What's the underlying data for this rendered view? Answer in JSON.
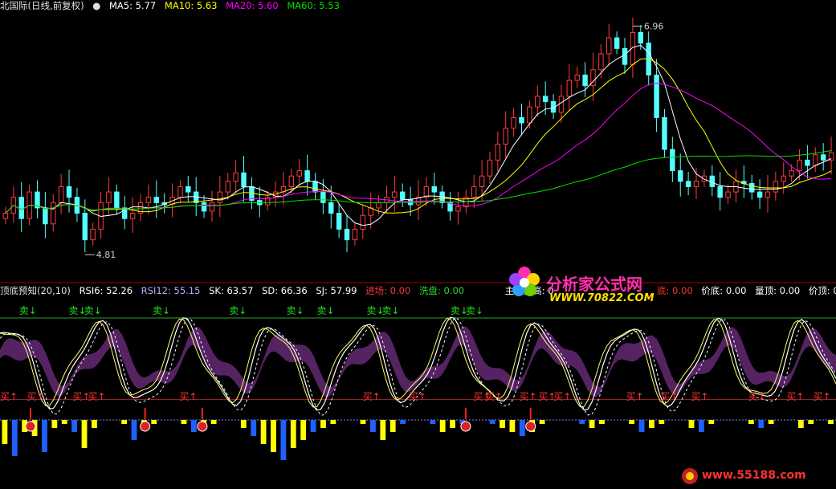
{
  "top_header": {
    "title": "北国际(日线,前复权)",
    "ma5": "MA5: 5.77",
    "ma10": "MA10: 5.63",
    "ma20": "MA20: 5.60",
    "ma60": "MA60: 5.53"
  },
  "bottom_header": {
    "title": "顶底预知(20,10)",
    "rsi6": "RSI6: 52.26",
    "rsi12": "RSI12: 55.15",
    "sk": "SK: 63.57",
    "sd": "SD: 66.36",
    "sj": "SJ: 57.99",
    "entry": "进场: 0.00",
    "wash": "洗盘: 0.00",
    "main_raise": "主力拉高: 0",
    "bottom": "底: 0.00",
    "price_bottom": "价底: 0.00",
    "vol_top": "量顶: 0.00",
    "price_top": "价顶: 0.00"
  },
  "watermarks": {
    "site_name": "分析家公式网",
    "site_url": "WWW.70822.COM",
    "corner_url": "www.55188.com"
  },
  "colors": {
    "background": "#000000",
    "candle_up": "#ff3c3c",
    "candle_down": "#54ffff",
    "ma5": "#ffffff",
    "ma10": "#ffff00",
    "ma20": "#ff00ff",
    "ma60": "#00e000",
    "buy_label": "#ff3333",
    "sell_label": "#22dd22",
    "hist_yellow": "#ffff00",
    "hist_blue": "#2060ff"
  },
  "chart_data": [
    {
      "type": "candlestick",
      "title": "北国际(日线,前复权)",
      "ylim": [
        4.6,
        7.1
      ],
      "annotations": [
        {
          "label": "6.96",
          "value": 6.96,
          "kind": "high"
        },
        {
          "label": "4.81",
          "value": 4.81,
          "kind": "low"
        }
      ],
      "closes": [
        5.2,
        5.35,
        5.15,
        5.4,
        5.25,
        5.1,
        5.3,
        5.45,
        5.35,
        5.2,
        4.95,
        5.05,
        5.3,
        5.4,
        5.25,
        5.15,
        5.2,
        5.3,
        5.35,
        5.3,
        5.28,
        5.35,
        5.45,
        5.4,
        5.3,
        5.22,
        5.3,
        5.4,
        5.5,
        5.58,
        5.45,
        5.32,
        5.28,
        5.35,
        5.4,
        5.45,
        5.55,
        5.6,
        5.5,
        5.4,
        5.3,
        5.2,
        5.05,
        4.95,
        5.05,
        5.18,
        5.25,
        5.3,
        5.35,
        5.4,
        5.33,
        5.28,
        5.35,
        5.45,
        5.4,
        5.3,
        5.22,
        5.26,
        5.35,
        5.45,
        5.55,
        5.7,
        5.85,
        6.0,
        6.1,
        6.05,
        6.2,
        6.3,
        6.25,
        6.15,
        6.3,
        6.45,
        6.5,
        6.4,
        6.55,
        6.7,
        6.85,
        6.75,
        6.6,
        6.9,
        6.8,
        6.5,
        6.1,
        5.8,
        5.6,
        5.5,
        5.45,
        5.5,
        5.55,
        5.45,
        5.35,
        5.4,
        5.5,
        5.48,
        5.4,
        5.35,
        5.4,
        5.5,
        5.55,
        5.6,
        5.7,
        5.65,
        5.75,
        5.7,
        5.77
      ],
      "series": [
        {
          "name": "MA5",
          "value": 5.77
        },
        {
          "name": "MA10",
          "value": 5.63
        },
        {
          "name": "MA20",
          "value": 5.6
        },
        {
          "name": "MA60",
          "value": 5.53
        }
      ]
    },
    {
      "type": "line",
      "title": "顶底预知(20,10)",
      "ylim": [
        0,
        100
      ],
      "reference_lines": [
        100,
        20,
        0
      ],
      "series": [
        {
          "name": "RSI6",
          "value": 52.26
        },
        {
          "name": "RSI12",
          "value": 55.15
        },
        {
          "name": "SK",
          "value": 63.57
        },
        {
          "name": "SD",
          "value": 66.36
        },
        {
          "name": "SJ",
          "value": 57.99
        }
      ],
      "sell_label": "卖↓",
      "buy_label": "买↑",
      "sell_markers_at": [
        5,
        18,
        22,
        40,
        60,
        75,
        83,
        96,
        100,
        118,
        122
      ],
      "buy_markers_at": [
        0,
        7,
        19,
        23,
        47,
        95,
        107,
        124,
        127,
        136,
        141,
        145,
        164,
        173,
        181,
        196,
        206,
        213
      ],
      "bottom_markers_at": [
        8,
        38,
        53,
        122,
        139
      ],
      "histogram": [
        0.6,
        0.9,
        0.3,
        0.4,
        0.8,
        0.2,
        0.1,
        0.3,
        0.7,
        0.2,
        0,
        0,
        0.1,
        0.5,
        0.2,
        0.1,
        0,
        0,
        0.1,
        0.3,
        0.2,
        0.1,
        0,
        0,
        0.2,
        0.4,
        0.6,
        0.8,
        1.0,
        0.7,
        0.5,
        0.3,
        0.2,
        0.1,
        0,
        0,
        0.1,
        0.3,
        0.5,
        0.3,
        0.1,
        0,
        0,
        0.1,
        0.3,
        0.2,
        0.1,
        0,
        0,
        0.1,
        0.2,
        0.3,
        0.4,
        0.3,
        0.1,
        0,
        0,
        0,
        0.1,
        0.2,
        0.1,
        0,
        0,
        0.1,
        0.3,
        0.2,
        0.1,
        0,
        0,
        0.2,
        0.3,
        0.1,
        0,
        0,
        0,
        0.1,
        0.2,
        0.1,
        0,
        0,
        0.2,
        0.1,
        0,
        0.1
      ]
    }
  ]
}
